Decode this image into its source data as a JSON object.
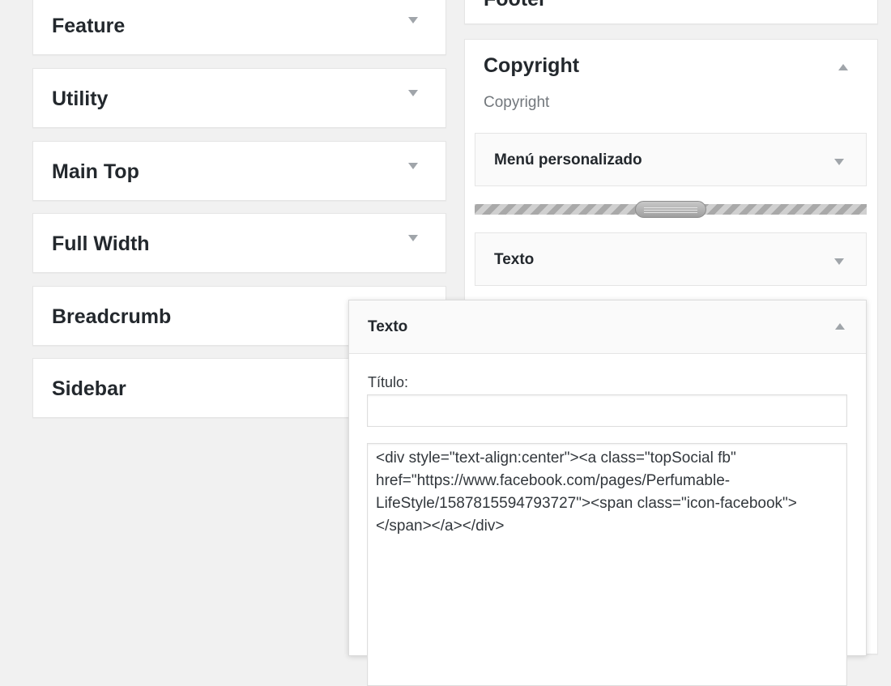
{
  "left_sidebars": [
    {
      "title": "Feature"
    },
    {
      "title": "Utility"
    },
    {
      "title": "Main Top"
    },
    {
      "title": "Full Width"
    },
    {
      "title": "Breadcrumb"
    },
    {
      "title": "Sidebar"
    }
  ],
  "right_sidebars": {
    "footer": {
      "title": "Footer"
    },
    "copyright": {
      "title": "Copyright",
      "description": "Copyright",
      "widgets": [
        {
          "title": "Menú personalizado"
        },
        {
          "title": "Texto"
        }
      ]
    }
  },
  "dragging_widget": {
    "title": "Texto",
    "title_field_label": "Título:",
    "title_value": "",
    "content": "<div style=\"text-align:center\"><a class=\"topSocial fb\" href=\"https://www.facebook.com/pages/Perfumable-LifeStyle/1587815594793727\"><span class=\"icon-facebook\"> </span></a></div>"
  },
  "icons": {
    "collapse": "chevron-down-icon",
    "expand": "chevron-up-icon"
  }
}
